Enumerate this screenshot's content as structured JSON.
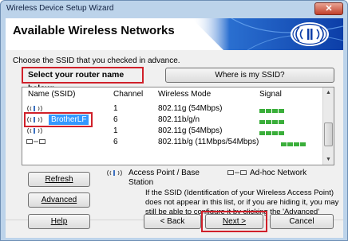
{
  "window": {
    "title": "Wireless Device Setup Wizard",
    "close_glyph": "✕"
  },
  "banner": {
    "title": "Available Wireless Networks"
  },
  "hint": "Choose the SSID that you checked in advance.",
  "select_label": "Select your router name below:",
  "buttons": {
    "where_ssid": "Where is my SSID?",
    "refresh": "Refresh",
    "advanced": "Advanced",
    "help": "Help",
    "back": "< Back",
    "next": "Next >",
    "cancel": "Cancel"
  },
  "table": {
    "headers": {
      "name": "Name (SSID)",
      "channel": "Channel",
      "mode": "Wireless Mode",
      "signal": "Signal"
    },
    "rows": [
      {
        "name": "",
        "channel": "1",
        "mode": "802.11g (54Mbps)",
        "icon": "access-point-icon",
        "signal_bars": 4
      },
      {
        "name": "BrotherLF",
        "channel": "6",
        "mode": "802.11b/g/n",
        "icon": "access-point-icon",
        "signal_bars": 4,
        "selected": true
      },
      {
        "name": "",
        "channel": "1",
        "mode": "802.11g (54Mbps)",
        "icon": "access-point-icon",
        "signal_bars": 4
      },
      {
        "name": "",
        "channel": "6",
        "mode": "802.11b/g (11Mbps/54Mbps)",
        "icon": "ad-hoc-icon",
        "signal_bars": 4
      }
    ]
  },
  "legend": {
    "access_point": "Access Point / Base\nStation",
    "ad_hoc": "Ad-hoc Network"
  },
  "info_text": "If the SSID (Identification of your Wireless Access Point) does not appear in this list, or if you are hiding it, you may still be able to configure it by clicking the 'Advanced' button.",
  "colors": {
    "highlight": "#d0202a",
    "selection": "#3399ff",
    "signal": "#3aae3a"
  }
}
